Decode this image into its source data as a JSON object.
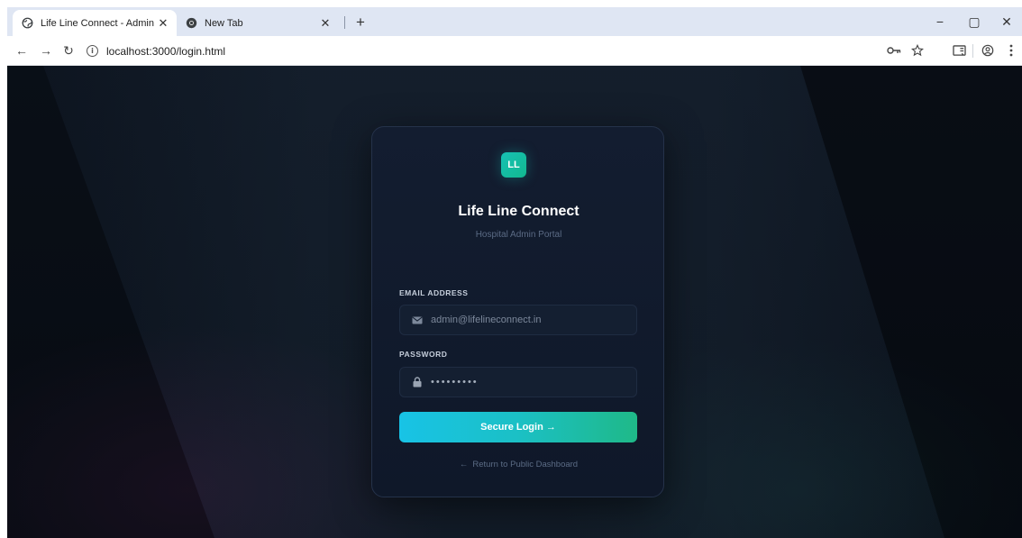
{
  "browser": {
    "tabs": [
      {
        "title": "Life Line Connect - Admin Login",
        "active": true,
        "icon": "globe-icon"
      },
      {
        "title": "New Tab",
        "active": false,
        "icon": "chrome-icon"
      }
    ],
    "url": "localhost:3000/login.html",
    "close_glyph": "✕",
    "new_tab_glyph": "+",
    "nav": {
      "back": "←",
      "forward": "→",
      "reload": "↻"
    },
    "window_controls": {
      "minimize": "−",
      "restore": "▢",
      "close": "✕"
    }
  },
  "login": {
    "logo_text": "LL",
    "app_name": "Life Line Connect",
    "subtitle": "Hospital Admin Portal",
    "email_label": "EMAIL ADDRESS",
    "email_placeholder": "admin@lifelineconnect.in",
    "password_label": "PASSWORD",
    "password_value": "•••••••••",
    "button_label": "Secure Login →",
    "return_arrow": "←",
    "return_text": "Return to Public Dashboard"
  },
  "colors": {
    "accent_start": "#18c3e6",
    "accent_end": "#1fb988",
    "page_bg": "#0d141f",
    "card_bg": "#131d30"
  }
}
